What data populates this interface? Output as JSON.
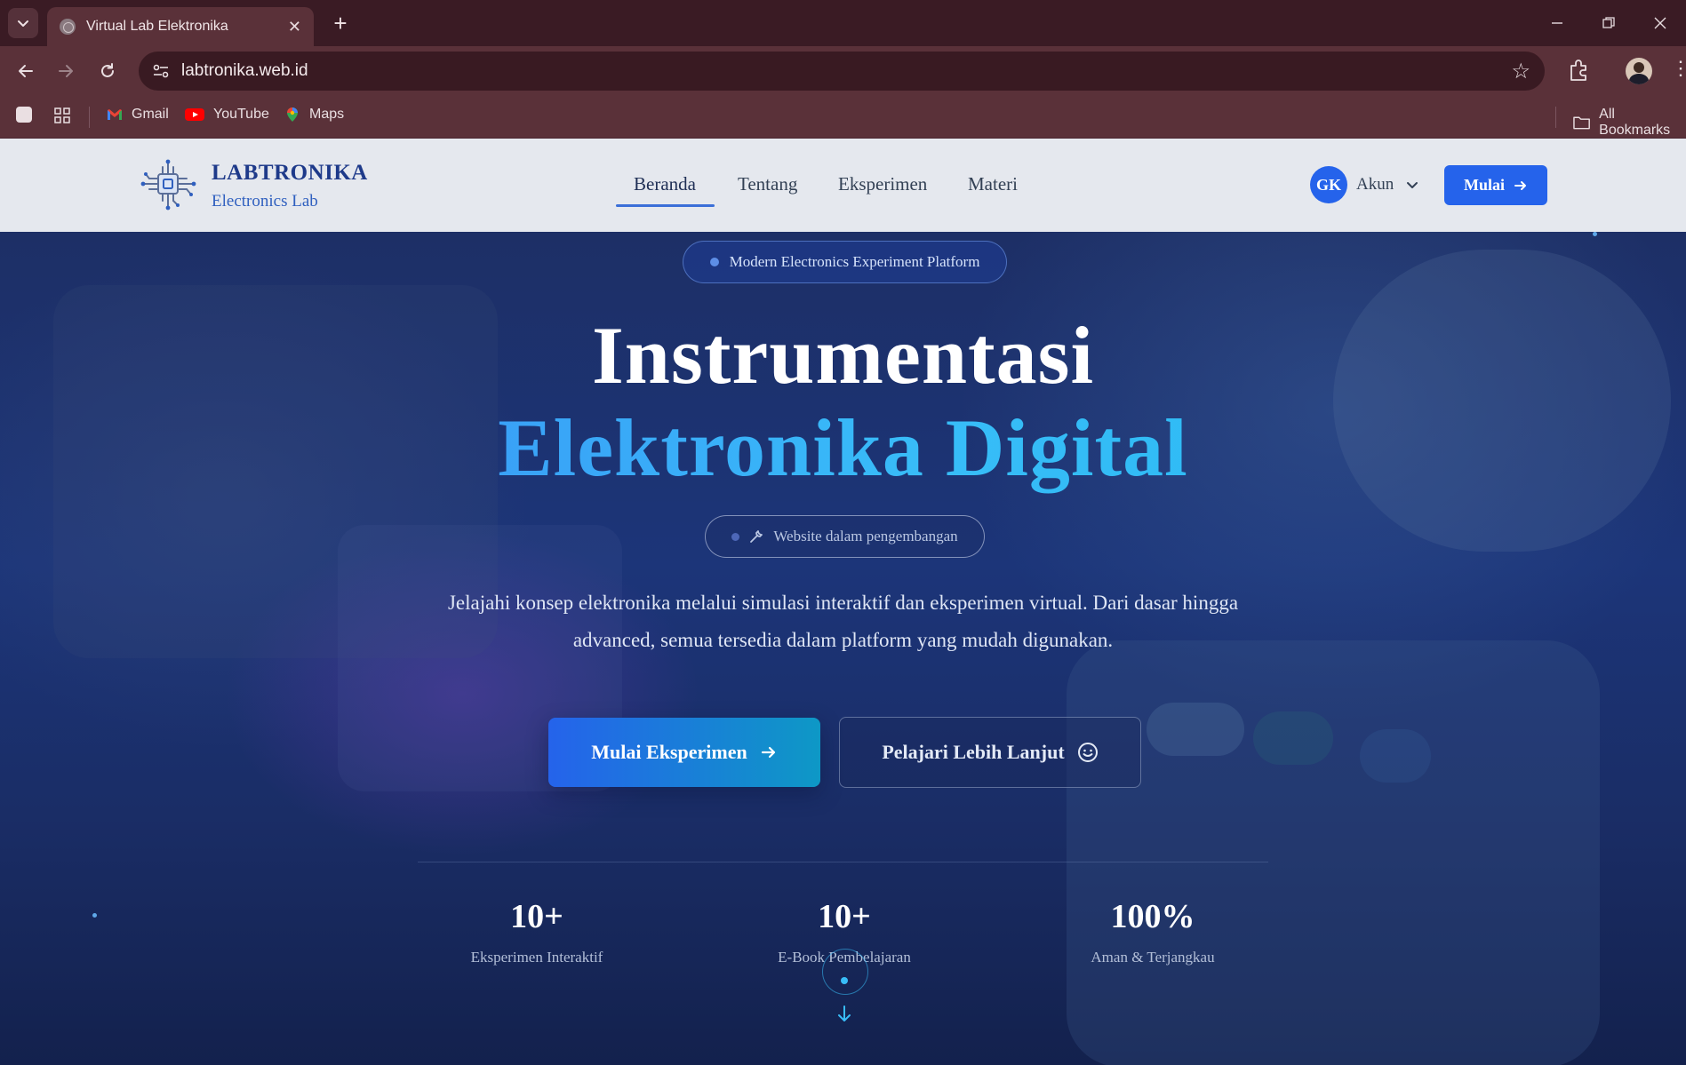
{
  "browser": {
    "tab_title": "Virtual Lab Elektronika",
    "url": "labtronika.web.id",
    "bookmarks": [
      {
        "label": "Gmail",
        "icon": "gmail-icon"
      },
      {
        "label": "YouTube",
        "icon": "youtube-icon"
      },
      {
        "label": "Maps",
        "icon": "maps-icon"
      }
    ],
    "all_bookmarks": "All Bookmarks"
  },
  "header": {
    "brand": "LABTRONIKA",
    "brand_sub": "Electronics Lab",
    "nav": [
      "Beranda",
      "Tentang",
      "Eksperimen",
      "Materi"
    ],
    "active_nav": "Beranda",
    "avatar_initials": "GK",
    "account_label": "Akun",
    "cta_label": "Mulai"
  },
  "hero": {
    "badge": "Modern Electronics Experiment Platform",
    "title_line1": "Instrumentasi",
    "title_line2": "Elektronika Digital",
    "dev_badge": "Website dalam pengembangan",
    "description": "Jelajahi konsep elektronika melalui simulasi interaktif dan eksperimen virtual. Dari dasar hingga advanced, semua tersedia dalam platform yang mudah digunakan.",
    "primary_button": "Mulai Eksperimen",
    "secondary_button": "Pelajari Lebih Lanjut",
    "stats": [
      {
        "value": "10+",
        "label": "Eksperimen Interaktif"
      },
      {
        "value": "10+",
        "label": "E-Book Pembelajaran"
      },
      {
        "value": "100%",
        "label": "Aman & Terjangkau"
      }
    ]
  },
  "colors": {
    "brand_blue": "#2563eb",
    "brand_dark": "#1e3a8a",
    "accent_cyan": "#38bdf8",
    "browser_frame": "#5a3139"
  }
}
